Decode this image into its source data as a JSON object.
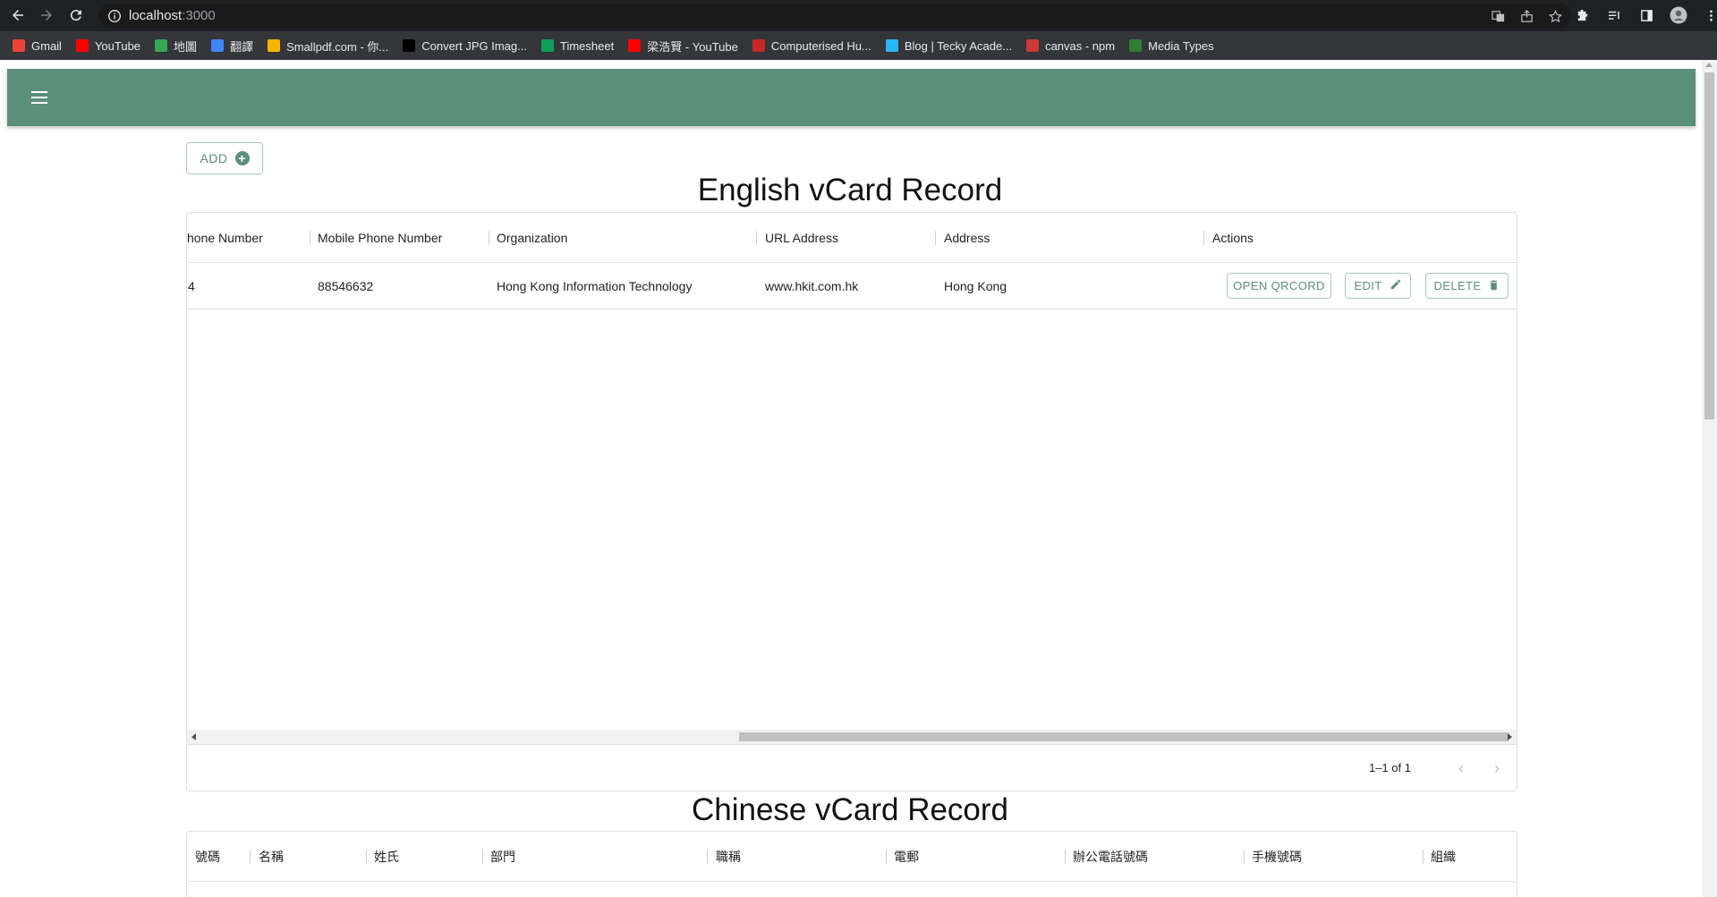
{
  "browser": {
    "url_host": "localhost",
    "url_port": ":3000"
  },
  "bookmarks": [
    {
      "label": "Gmail",
      "color": "#ea4335"
    },
    {
      "label": "YouTube",
      "color": "#ff0000"
    },
    {
      "label": "地圖",
      "color": "#34a853"
    },
    {
      "label": "翻譯",
      "color": "#4285f4"
    },
    {
      "label": "Smallpdf.com - 你...",
      "color": "#f4b400"
    },
    {
      "label": "Convert JPG Imag...",
      "color": "#000000"
    },
    {
      "label": "Timesheet",
      "color": "#0f9d58"
    },
    {
      "label": "梁浩賢 - YouTube",
      "color": "#ff0000"
    },
    {
      "label": "Computerised Hu...",
      "color": "#c62828"
    },
    {
      "label": "Blog | Tecky Acade...",
      "color": "#29b6f6"
    },
    {
      "label": "canvas - npm",
      "color": "#cb3837"
    },
    {
      "label": "Media Types",
      "color": "#2e7d32"
    }
  ],
  "toolbar": {
    "add_label": "ADD"
  },
  "english": {
    "title": "English vCard Record",
    "columns": [
      "hone Number",
      "Mobile Phone Number",
      "Organization",
      "URL Address",
      "Address",
      "Actions"
    ],
    "rows": [
      {
        "phone": "4",
        "mobile": "88546632",
        "organization": "Hong Kong Information Technology",
        "url": "www.hkit.com.hk",
        "address": "Hong Kong"
      }
    ],
    "actions": {
      "qr": "OPEN QRCORD",
      "edit": "EDIT",
      "delete": "DELETE"
    },
    "pagination": "1–1 of 1"
  },
  "chinese": {
    "title": "Chinese vCard Record",
    "columns": [
      "號碼",
      "名稱",
      "姓氏",
      "部門",
      "職稱",
      "電郵",
      "辦公電話號碼",
      "手機號碼",
      "組織"
    ]
  },
  "colors": {
    "brand": "#5b8f7b"
  }
}
